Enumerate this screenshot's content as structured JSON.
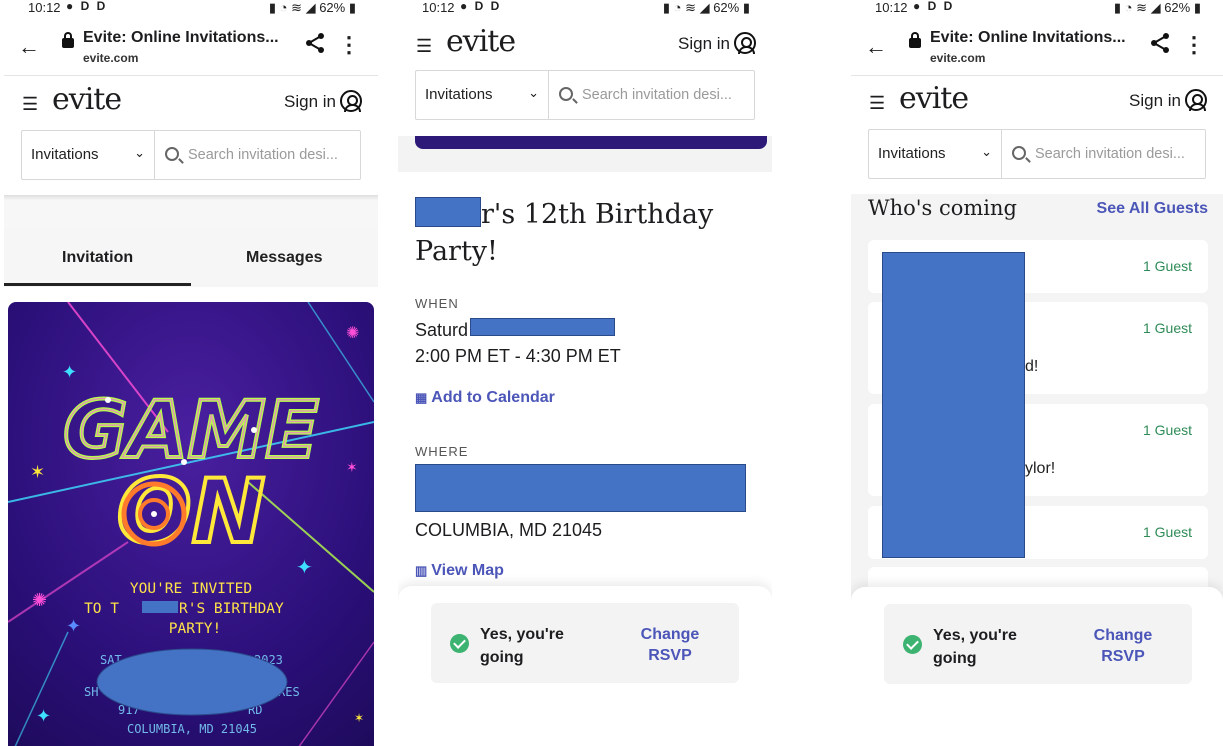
{
  "status": {
    "time": "10:12",
    "icons_left": "● D D",
    "battery": "62%"
  },
  "browser": {
    "page_title": "Evite: Online Invitations...",
    "domain": "evite.com"
  },
  "site": {
    "logo": "evite",
    "sign_in": "Sign in",
    "dropdown_value": "Invitations",
    "search_placeholder": "Search invitation desi..."
  },
  "screen1": {
    "tabs": [
      "Invitation",
      "Messages"
    ],
    "card": {
      "art_line1": "GAME",
      "art_line2": "ON",
      "invite_line1": "YOU'RE INVITED",
      "invite_line2a": "TO T",
      "invite_line2b": "R'S BIRTHDAY",
      "invite_line3": "PARTY!",
      "date_frag_left": "SAT",
      "date_frag_right": "2023",
      "venue_frag_left": "SH",
      "venue_frag_right": "RES",
      "addr_frag_left": "917",
      "addr_frag_right": "RD",
      "city": "COLUMBIA, MD 21045"
    }
  },
  "screen2": {
    "title_rest": "r's 12th Birthday",
    "title_line2": "Party!",
    "when_label": "WHEN",
    "date_frag": "Saturd",
    "time": "2:00 PM ET - 4:30 PM ET",
    "add_calendar": "Add to Calendar",
    "where_label": "WHERE",
    "city": "COLUMBIA, MD 21045",
    "view_map": "View Map"
  },
  "screen3": {
    "who_title": "Who's coming",
    "see_all": "See All Guests",
    "guests": [
      {
        "count": "1 Guest",
        "message": ""
      },
      {
        "count": "1 Guest",
        "message": "d!"
      },
      {
        "count": "1 Guest",
        "message": "ylor!"
      },
      {
        "count": "1 Guest",
        "message": ""
      }
    ]
  },
  "rsvp": {
    "status": "Yes, you're going",
    "change": "Change RSVP"
  },
  "colors": {
    "accent": "#4b56b8",
    "success": "#3cb371",
    "redaction": "#4472c4"
  }
}
